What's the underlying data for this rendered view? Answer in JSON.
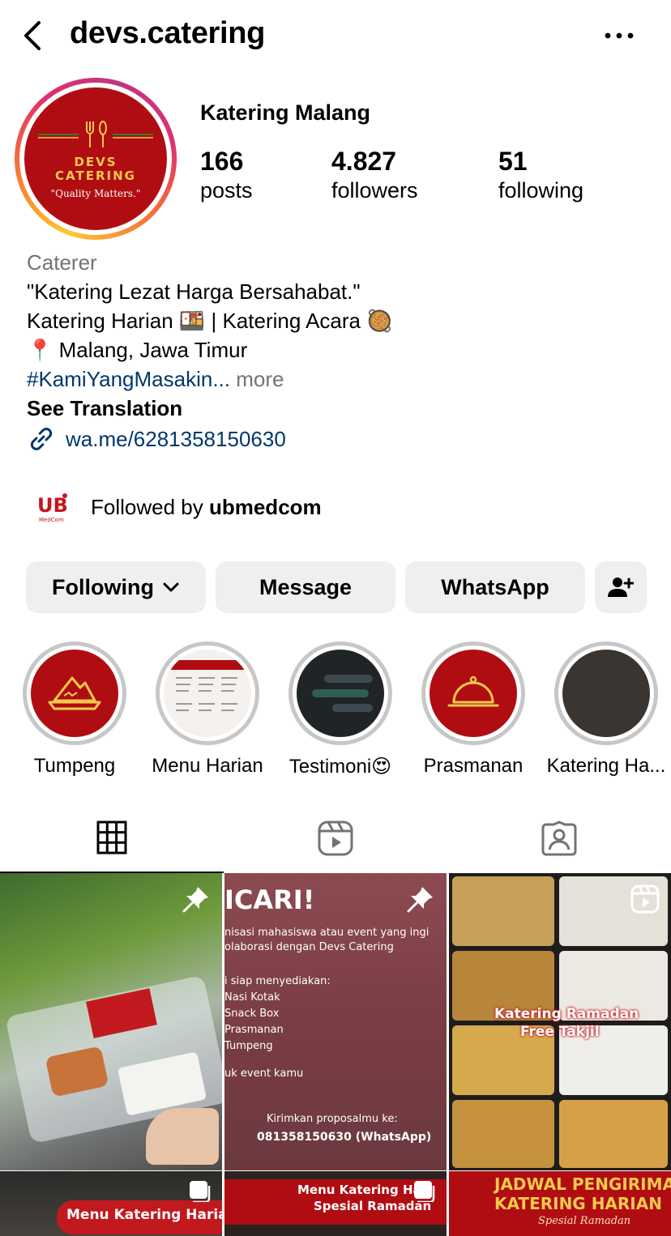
{
  "header": {
    "username": "devs.catering"
  },
  "profile": {
    "avatar_brand": "DEVS CATERING",
    "avatar_tagline": "\"Quality Matters.\"",
    "display_name": "Katering Malang",
    "stats": [
      {
        "value": "166",
        "label": "posts"
      },
      {
        "value": "4.827",
        "label": "followers"
      },
      {
        "value": "51",
        "label": "following"
      }
    ]
  },
  "bio": {
    "category": "Caterer",
    "line1": "\"Katering Lezat Harga Bersahabat.\"",
    "line2": "Katering Harian 🍱 | Katering Acara 🥘",
    "line3": "📍 Malang, Jawa Timur",
    "hashtag": "#KamiYangMasakin",
    "ellipsis": "...",
    "more": " more",
    "see_translation": "See Translation",
    "link": "wa.me/6281358150630"
  },
  "followed_by": {
    "prefix": "Followed by ",
    "user": "ubmedcom",
    "avatar_text": "UB",
    "avatar_sub": "MedCom"
  },
  "actions": {
    "following": "Following",
    "message": "Message",
    "whatsapp": "WhatsApp"
  },
  "highlights": [
    {
      "label": "Tumpeng"
    },
    {
      "label": "Menu Harian"
    },
    {
      "label": "Testimoni😍"
    },
    {
      "label": "Prasmanan"
    },
    {
      "label": "Katering Ha..."
    }
  ],
  "posts": {
    "p2_title": "ICARI!",
    "p2_line1": "nisasi mahasiswa atau event yang ingi",
    "p2_line2": "olaborasi dengan Devs Catering",
    "p2_line3": "i siap menyediakan:",
    "p2_items": [
      "Nasi Kotak",
      "Snack Box",
      "Prasmanan",
      "Tumpeng"
    ],
    "p2_line4": "uk event kamu",
    "p2_cta": "Kirimkan proposalmu ke:",
    "p2_phone": "081358150630 (WhatsApp)",
    "p3_title": "Katering Ramadan",
    "p3_sub": "Free Takjil",
    "p4_text": "Menu Katering Harian",
    "p5_line1": "Menu Katering Ha",
    "p5_line2": "Spesial Ramadan",
    "p6_line1": "JADWAL PENGIRIMA",
    "p6_line2": "KATERING HARIAN",
    "p6_line3": "Spesial Ramadan"
  },
  "colors": {
    "brand_red": "#b00d12",
    "link_blue": "#00376b",
    "button_gray": "#efefef"
  }
}
